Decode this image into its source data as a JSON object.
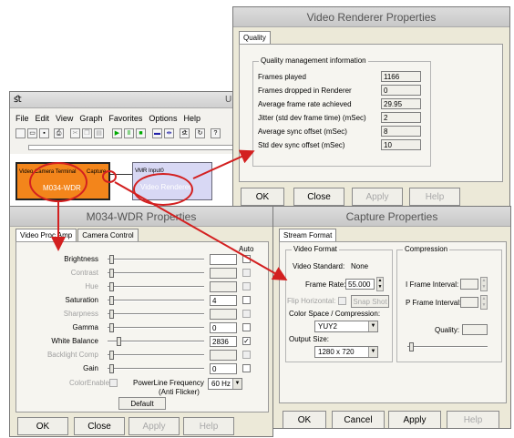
{
  "graphedit": {
    "title_fragment": "U",
    "menu": [
      "File",
      "Edit",
      "View",
      "Graph",
      "Favorites",
      "Options",
      "Help"
    ],
    "camera_filter": {
      "label": "M034-WDR",
      "pin_in": "Video Camera Terminal",
      "pin_out": "Capture"
    },
    "renderer_filter": {
      "label": "Video Renderer",
      "pin_in": "VMR Input0"
    }
  },
  "renderer_props": {
    "title": "Video Renderer Properties",
    "tab": "Quality",
    "group": "Quality management information",
    "rows": [
      {
        "label": "Frames played",
        "value": "1166"
      },
      {
        "label": "Frames dropped in Renderer",
        "value": "0"
      },
      {
        "label": "Average frame rate achieved",
        "value": "29.95"
      },
      {
        "label": "Jitter (std dev frame time) (mSec)",
        "value": "2"
      },
      {
        "label": "Average sync offset (mSec)",
        "value": "8"
      },
      {
        "label": "Std dev sync offset (mSec)",
        "value": "10"
      }
    ],
    "buttons": {
      "ok": "OK",
      "close": "Close",
      "apply": "Apply",
      "help": "Help"
    }
  },
  "camera_props": {
    "title": "M034-WDR Properties",
    "tabs": [
      "Video Proc Amp",
      "Camera Control"
    ],
    "auto_header": "Auto",
    "rows": [
      {
        "label": "Brightness",
        "value": "",
        "enabled": true,
        "auto": false
      },
      {
        "label": "Contrast",
        "value": "",
        "enabled": false,
        "auto": false
      },
      {
        "label": "Hue",
        "value": "",
        "enabled": false,
        "auto": false
      },
      {
        "label": "Saturation",
        "value": "4",
        "enabled": true,
        "auto": false
      },
      {
        "label": "Sharpness",
        "value": "",
        "enabled": false,
        "auto": false
      },
      {
        "label": "Gamma",
        "value": "0",
        "enabled": true,
        "auto": false
      },
      {
        "label": "White Balance",
        "value": "2836",
        "enabled": true,
        "auto": true
      },
      {
        "label": "Backlight Comp",
        "value": "",
        "enabled": false,
        "auto": false
      },
      {
        "label": "Gain",
        "value": "0",
        "enabled": true,
        "auto": false
      }
    ],
    "color_enable": "ColorEnable",
    "powerline_label": "PowerLine Frequency",
    "powerline_sub": "(Anti Flicker)",
    "powerline_value": "60 Hz",
    "default_button": "Default",
    "buttons": {
      "ok": "OK",
      "close": "Close",
      "apply": "Apply",
      "help": "Help"
    }
  },
  "capture_props": {
    "title": "Capture Properties",
    "tab": "Stream Format",
    "video_format_group": "Video Format",
    "compression_group": "Compression",
    "video_standard_label": "Video Standard:",
    "video_standard_value": "None",
    "frame_rate_label": "Frame Rate:",
    "frame_rate_value": "55.000",
    "flip_horizontal_label": "Flip Horizontal:",
    "snap_shot_button": "Snap Shot",
    "color_space_label": "Color Space / Compression:",
    "color_space_value": "YUY2",
    "output_size_label": "Output Size:",
    "output_size_value": "1280 x 720",
    "iframe_label": "I Frame Interval:",
    "pframe_label": "P Frame Interval:",
    "quality_label": "Quality:",
    "buttons": {
      "ok": "OK",
      "cancel": "Cancel",
      "apply": "Apply",
      "help": "Help"
    }
  }
}
